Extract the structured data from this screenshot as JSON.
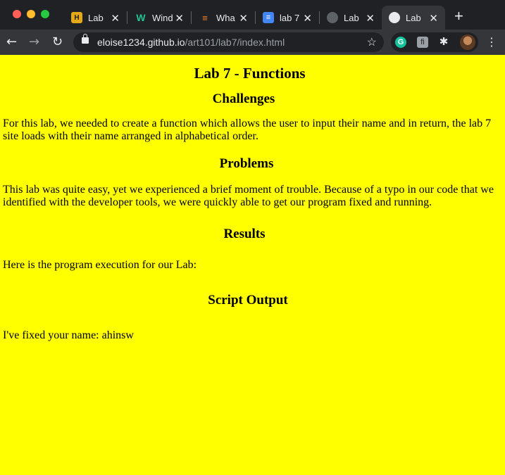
{
  "browser": {
    "tabs": [
      {
        "title": "Lab",
        "icon": "lab-book-favicon",
        "active": false
      },
      {
        "title": "Wind",
        "icon": "w-favicon",
        "active": false
      },
      {
        "title": "Wha",
        "icon": "stackoverflow-favicon",
        "active": false
      },
      {
        "title": "lab 7",
        "icon": "google-docs-favicon",
        "active": false
      },
      {
        "title": "Lab",
        "icon": "globe-favicon",
        "active": false
      },
      {
        "title": "Lab",
        "icon": "globe-favicon",
        "active": true
      }
    ],
    "new_tab_label": "+",
    "url_host": "eloise1234.github.io",
    "url_path": "/art101/lab7/index.html"
  },
  "page": {
    "title": "Lab 7 - Functions",
    "challenges_heading": "Challenges",
    "challenges_text": "For this lab, we needed to create a function which allows the user to input their name and in return, the lab 7 site loads with their name arranged in alphabetical order.",
    "problems_heading": "Problems",
    "problems_text": "This lab was quite easy, yet we experienced a brief moment of trouble. Because of a typo in our code that we identified with the developer tools, we were quickly able to get our program fixed and running.",
    "results_heading": "Results",
    "results_text": "Here is the program execution for our Lab:",
    "script_heading": "Script Output",
    "script_output": "I've fixed your name: ahinsw"
  }
}
